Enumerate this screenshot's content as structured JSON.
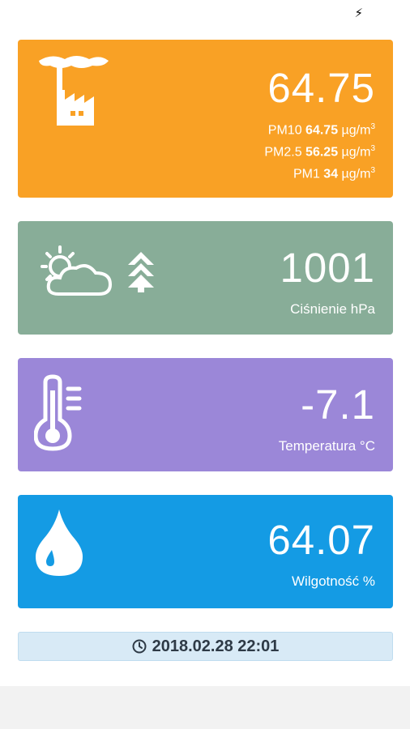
{
  "status_bar": {
    "icon": "flash-icon",
    "glyph": "⚡"
  },
  "pm_card": {
    "icon": "factory-smog-icon",
    "main_value": "64.75",
    "pm10": {
      "label": "PM10",
      "value": "64.75",
      "unit": "µg/m",
      "exp": "3"
    },
    "pm25": {
      "label": "PM2.5",
      "value": "56.25",
      "unit": "µg/m",
      "exp": "3"
    },
    "pm1": {
      "label": "PM1",
      "value": "34",
      "unit": "µg/m",
      "exp": "3"
    },
    "color": "#f9a125"
  },
  "pressure_card": {
    "icons": [
      "sun-cloud-icon",
      "pressure-arrows-icon"
    ],
    "value": "1001",
    "label": "Ciśnienie hPa",
    "color": "#88ad98"
  },
  "temperature_card": {
    "icon": "thermometer-icon",
    "value": "-7.1",
    "label": "Temperatura °C",
    "color": "#9b87d8"
  },
  "humidity_card": {
    "icon": "water-drop-icon",
    "value": "64.07",
    "label": "Wilgotność %",
    "color": "#149be4"
  },
  "timestamp": {
    "icon": "clock-icon",
    "text": "2018.02.28 22:01"
  }
}
